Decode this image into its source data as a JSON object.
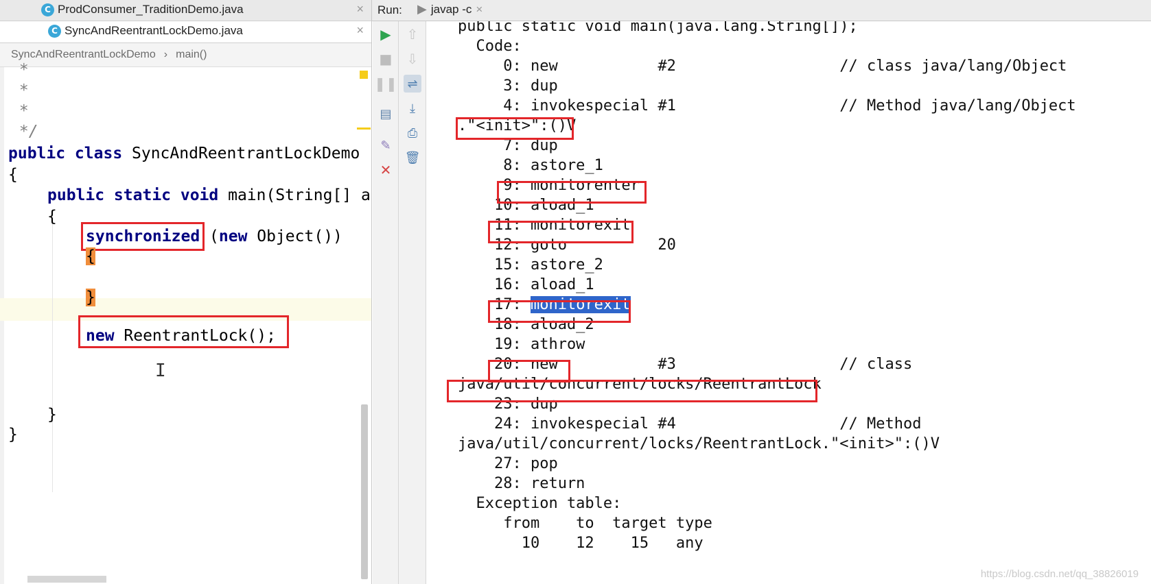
{
  "editor": {
    "tabs": [
      {
        "icon": "C",
        "label": "ProdConsumer_TraditionDemo.java",
        "close": "×"
      },
      {
        "icon": "C",
        "label": "SyncAndReentrantLockDemo.java",
        "close": "×"
      }
    ],
    "breadcrumb": {
      "class": "SyncAndReentrantLockDemo",
      "sep": "›",
      "method": "main()"
    },
    "lines": {
      "c1": " *",
      "c2": " *",
      "c3": " *",
      "c4": " */",
      "l_class_kw": "public class",
      "l_class_name": " SyncAndReentrantLockDemo",
      "l_open1": "{",
      "l_main_kw": "public static void",
      "l_main_rest": " main(String[] a",
      "l_open2": "{",
      "l_sync_kw": "synchronized",
      "l_sync_rest1": " (",
      "l_sync_new": "new",
      "l_sync_rest2": " Object())",
      "l_brace_open": "{",
      "l_brace_close": "}",
      "l_new_kw": "new",
      "l_new_rest": " ReentrantLock();",
      "l_close2": "}",
      "l_close1": "}"
    }
  },
  "run": {
    "label": "Run:",
    "tab": "javap -c",
    "tab_close": "×",
    "output": [
      "public static void main(java.lang.String[]);",
      "  Code:",
      "     0: new           #2                  // class java/lang/Object",
      "     3: dup",
      "     4: invokespecial #1                  // Method java/lang/Object",
      ".\"<init>\":()V",
      "     7: dup",
      "     8: astore_1",
      "     9: monitorenter",
      "    10: aload_1",
      "    11: monitorexit",
      "    12: goto          20",
      "    15: astore_2",
      "    16: aload_1",
      "    17: ",
      "    18: aload_2",
      "    19: athrow",
      "    20: new           #3                  // class",
      "java/util/concurrent/locks/ReentrantLock",
      "    23: dup",
      "    24: invokespecial #4                  // Method",
      "java/util/concurrent/locks/ReentrantLock.\"<init>\":()V",
      "    27: pop",
      "    28: return",
      "  Exception table:",
      "     from    to  target type",
      "       10    12    15   any"
    ],
    "selected": "monitorexit"
  },
  "watermark": "https://blog.csdn.net/qq_38826019",
  "colors": {
    "keyword": "#000080",
    "highlight_box": "#e3262a",
    "selection": "#2f65ca",
    "brace_match": "#f08e3c"
  }
}
